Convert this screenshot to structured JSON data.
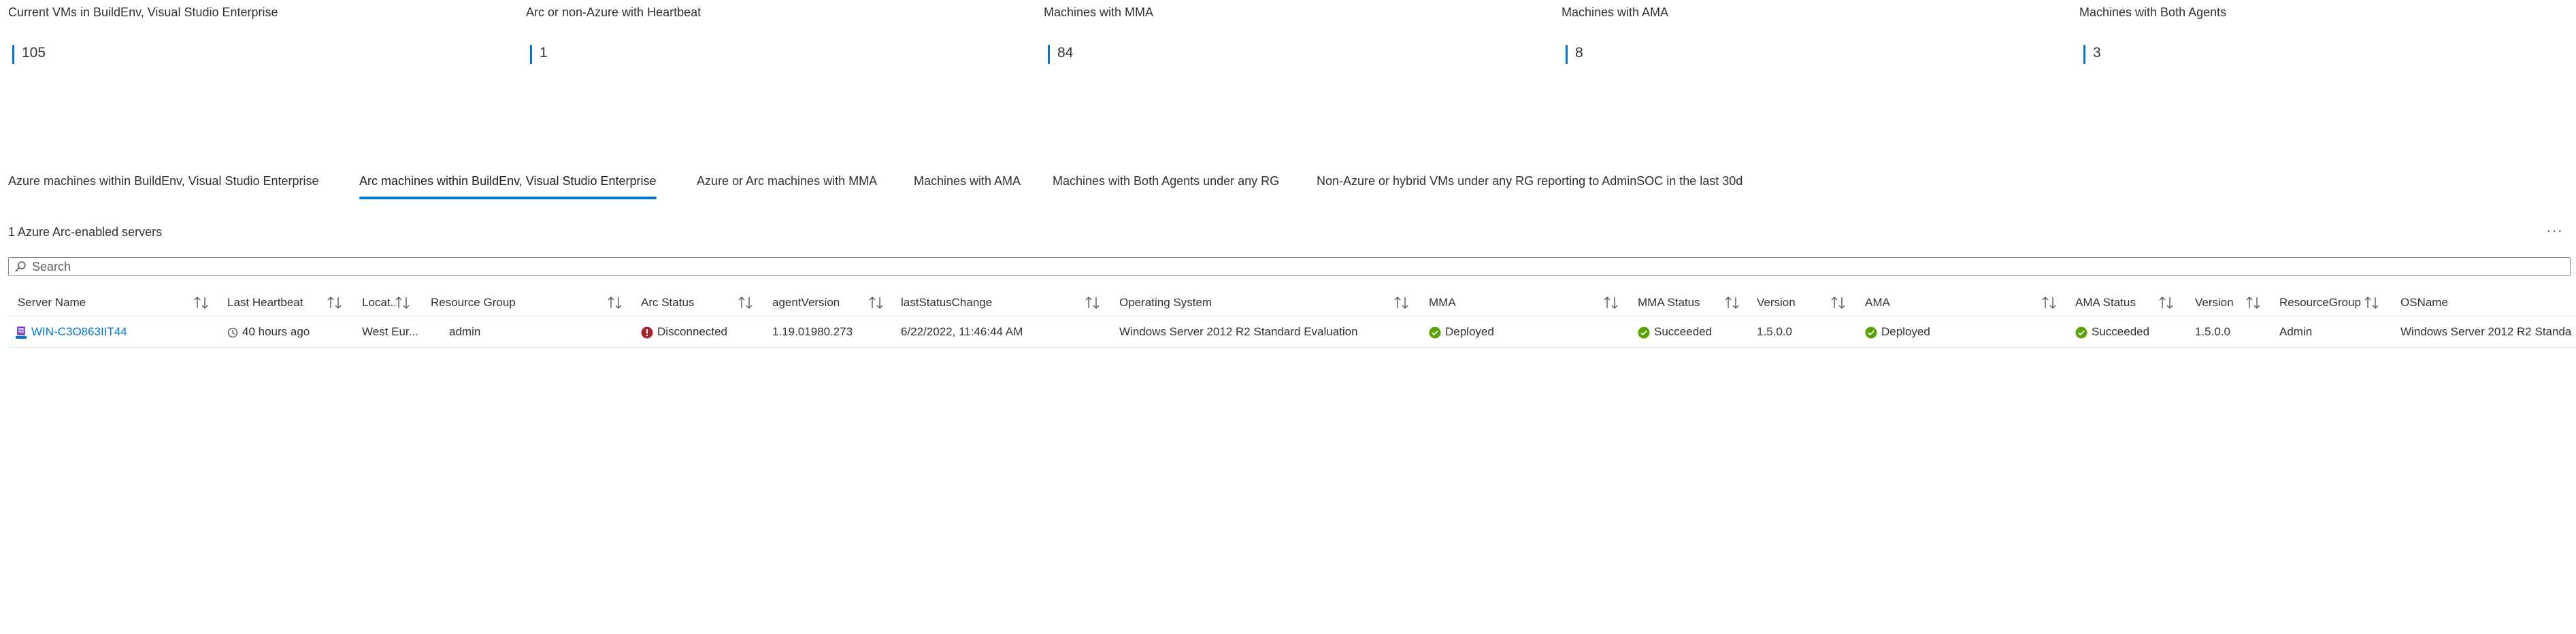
{
  "kpis": [
    {
      "title": "Current VMs in BuildEnv, Visual Studio Enterprise",
      "value": "105"
    },
    {
      "title": "Arc or non-Azure with Heartbeat",
      "value": "1"
    },
    {
      "title": "Machines with MMA",
      "value": "84"
    },
    {
      "title": "Machines with AMA",
      "value": "8"
    },
    {
      "title": "Machines with Both Agents",
      "value": "3"
    }
  ],
  "tabs": [
    {
      "label": "Azure machines within BuildEnv, Visual Studio Enterprise"
    },
    {
      "label": "Arc machines within BuildEnv, Visual Studio Enterprise",
      "active": true
    },
    {
      "label": "Azure or Arc machines with MMA"
    },
    {
      "label": "Machines with AMA"
    },
    {
      "label": "Machines with Both Agents under any RG"
    },
    {
      "label": "Non-Azure or hybrid VMs under any RG reporting to AdminSOC in the last 30d"
    }
  ],
  "grid": {
    "title": "1 Azure Arc-enabled servers",
    "more_label": "···",
    "search_placeholder": "Search",
    "columns": [
      "Server Name",
      "Last Heartbeat",
      "Locat..",
      "Resource Group",
      "Arc Status",
      "agentVersion",
      "lastStatusChange",
      "Operating System",
      "MMA",
      "MMA Status",
      "Version",
      "AMA",
      "AMA Status",
      "Version",
      "ResourceGroup",
      "OSName"
    ],
    "rows": [
      {
        "server_name": "WIN-C3O863IIT44",
        "last_heartbeat": "40 hours ago",
        "location": "West Eur...",
        "resource_group": "admin",
        "arc_status": "Disconnected",
        "agent_version": "1.19.01980.273",
        "last_status_change": "6/22/2022, 11:46:44 AM",
        "operating_system": "Windows Server 2012 R2 Standard Evaluation",
        "mma": "Deployed",
        "mma_status": "Succeeded",
        "mma_version": "1.5.0.0",
        "ama": "Deployed",
        "ama_status": "Succeeded",
        "ama_version": "1.5.0.0",
        "resource_group2": "Admin",
        "os_name": "Windows Server 2012 R2 Standa"
      }
    ]
  },
  "colors": {
    "accent": "#0078d4",
    "success": "#57a300",
    "error": "#a4262c"
  },
  "icons": {
    "server": "server-icon",
    "clock": "clock-icon",
    "error": "error-icon",
    "success": "check-circle-icon",
    "sort": "sort-icon",
    "search": "search-icon"
  }
}
